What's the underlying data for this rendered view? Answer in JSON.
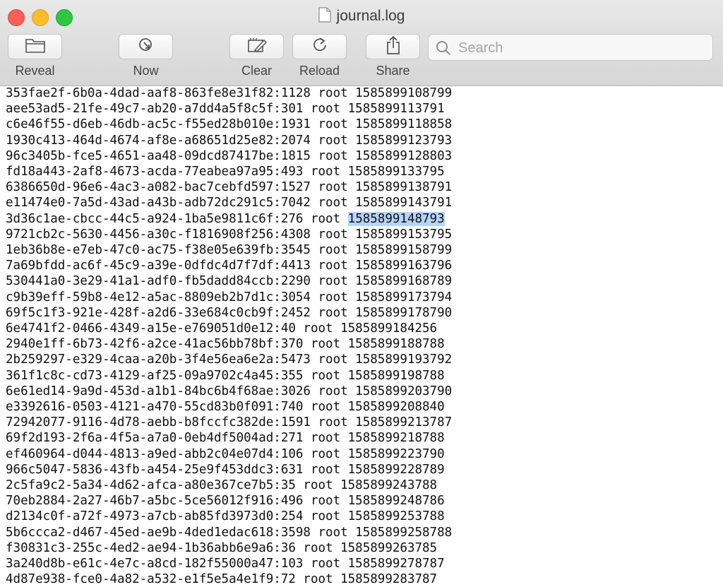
{
  "window": {
    "title": "journal.log"
  },
  "toolbar": {
    "reveal_label": "Reveal",
    "now_label": "Now",
    "clear_label": "Clear",
    "reload_label": "Reload",
    "share_label": "Share"
  },
  "search": {
    "placeholder": "Search",
    "value": ""
  },
  "log": {
    "lines": [
      {
        "text": "353fae2f-6b0a-4dad-aaf8-863fe8e31f82:1128 root 1585899108799"
      },
      {
        "text": "aee53ad5-21fe-49c7-ab20-a7dd4a5f8c5f:301 root 1585899113791"
      },
      {
        "text": "c6e46f55-d6eb-46db-ac5c-f55ed28b010e:1931 root 1585899118858"
      },
      {
        "text": "1930c413-464d-4674-af8e-a68651d25e82:2074 root 1585899123793"
      },
      {
        "text": "96c3405b-fce5-4651-aa48-09dcd87417be:1815 root 1585899128803"
      },
      {
        "text": "fd18a443-2af8-4673-acda-77eabea97a95:493 root 1585899133795"
      },
      {
        "text": "6386650d-96e6-4ac3-a082-bac7cebfd597:1527 root 1585899138791"
      },
      {
        "text": "e11474e0-7a5d-43ad-a43b-adb72dc291c5:7042 root 1585899143791"
      },
      {
        "prefix": "3d36c1ae-cbcc-44c5-a924-1ba5e9811c6f:276 root ",
        "selected": "1585899148793"
      },
      {
        "text": "9721cb2c-5630-4456-a30c-f1816908f256:4308 root 1585899153795"
      },
      {
        "text": "1eb36b8e-e7eb-47c0-ac75-f38e05e639fb:3545 root 1585899158799"
      },
      {
        "text": "7a69bfdd-ac6f-45c9-a39e-0dfdc4d7f7df:4413 root 1585899163796"
      },
      {
        "text": "530441a0-3e29-41a1-adf0-fb5dadd84ccb:2290 root 1585899168789"
      },
      {
        "text": "c9b39eff-59b8-4e12-a5ac-8809eb2b7d1c:3054 root 1585899173794"
      },
      {
        "text": "69f5c1f3-921e-428f-a2d6-33e684c0cb9f:2452 root 1585899178790"
      },
      {
        "text": "6e4741f2-0466-4349-a15e-e769051d0e12:40 root 1585899184256"
      },
      {
        "text": "2940e1ff-6b73-42f6-a2ce-41ac56bb78bf:370 root 1585899188788"
      },
      {
        "text": "2b259297-e329-4caa-a20b-3f4e56ea6e2a:5473 root 1585899193792"
      },
      {
        "text": "361f1c8c-cd73-4129-af25-09a9702c4a45:355 root 1585899198788"
      },
      {
        "text": "6e61ed14-9a9d-453d-a1b1-84bc6b4f68ae:3026 root 1585899203790"
      },
      {
        "text": "e3392616-0503-4121-a470-55cd83b0f091:740 root 1585899208840"
      },
      {
        "text": "72942077-9116-4d78-aebb-b8fccfc382de:1591 root 1585899213787"
      },
      {
        "text": "69f2d193-2f6a-4f5a-a7a0-0eb4df5004ad:271 root 1585899218788"
      },
      {
        "text": "ef460964-d044-4813-a9ed-abb2c04e07d4:106 root 1585899223790"
      },
      {
        "text": "966c5047-5836-43fb-a454-25e9f453ddc3:631 root 1585899228789"
      },
      {
        "text": "2c5fa9c2-5a34-4d62-afca-a80e367ce7b5:35 root 1585899243788"
      },
      {
        "text": "70eb2884-2a27-46b7-a5bc-5ce56012f916:496 root 1585899248786"
      },
      {
        "text": "d2134c0f-a72f-4973-a7cb-ab85fd3973d0:254 root 1585899253788"
      },
      {
        "text": "5b6ccca2-d467-45ed-ae9b-4ded1edac618:3598 root 1585899258788"
      },
      {
        "text": "f30831c3-255c-4ed2-ae94-1b36abb6e9a6:36 root 1585899263785"
      },
      {
        "text": "3a240d8b-e61c-4e7c-a8cd-182f55000a47:103 root 1585899278787"
      },
      {
        "text": "4d87e938-fce0-4a82-a532-e1f5e5a4e1f9:72 root 1585899283787"
      }
    ]
  }
}
